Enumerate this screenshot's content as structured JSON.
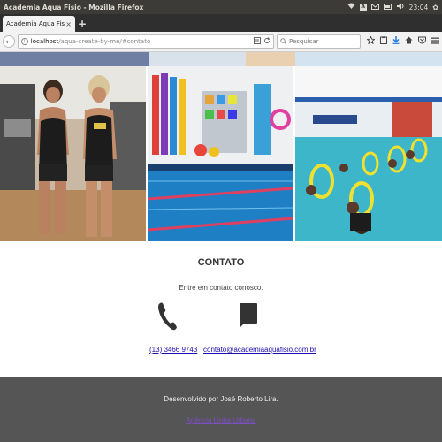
{
  "os": {
    "window_title": "Academia Aqua Fisio - Mozilla Firefox",
    "clock": "23:04",
    "tray_box": "A",
    "tray_icons": [
      "wifi-icon",
      "keyboard-icon",
      "mail-icon",
      "battery-icon",
      "volume-icon"
    ],
    "gear_glyph": "✿"
  },
  "browser": {
    "tab_title": "Academia Aqua Fisio",
    "tab_close": "×",
    "new_tab": "+",
    "url_host": "localhost",
    "url_path": "/aqua-create-by-me/#contato",
    "search_placeholder": "Pesquisar",
    "back_glyph": "←"
  },
  "page": {
    "contact": {
      "title": "CONTATO",
      "subtitle": "Entre em contato conosco.",
      "phone": "(13) 3466 9743",
      "email": "contato@academiaaquafisio.com.br"
    },
    "footer": {
      "credit": "Desenvolvido por José Roberto Lira.",
      "link": "Agência Linha Urbana"
    }
  },
  "colors": {
    "os_bar": "#3c3b37",
    "tab_strip": "#2f2f2f",
    "footer": "#555555",
    "link": "#1a0dab",
    "visited_link": "#7a4fbf",
    "icon_dark": "#333333"
  }
}
